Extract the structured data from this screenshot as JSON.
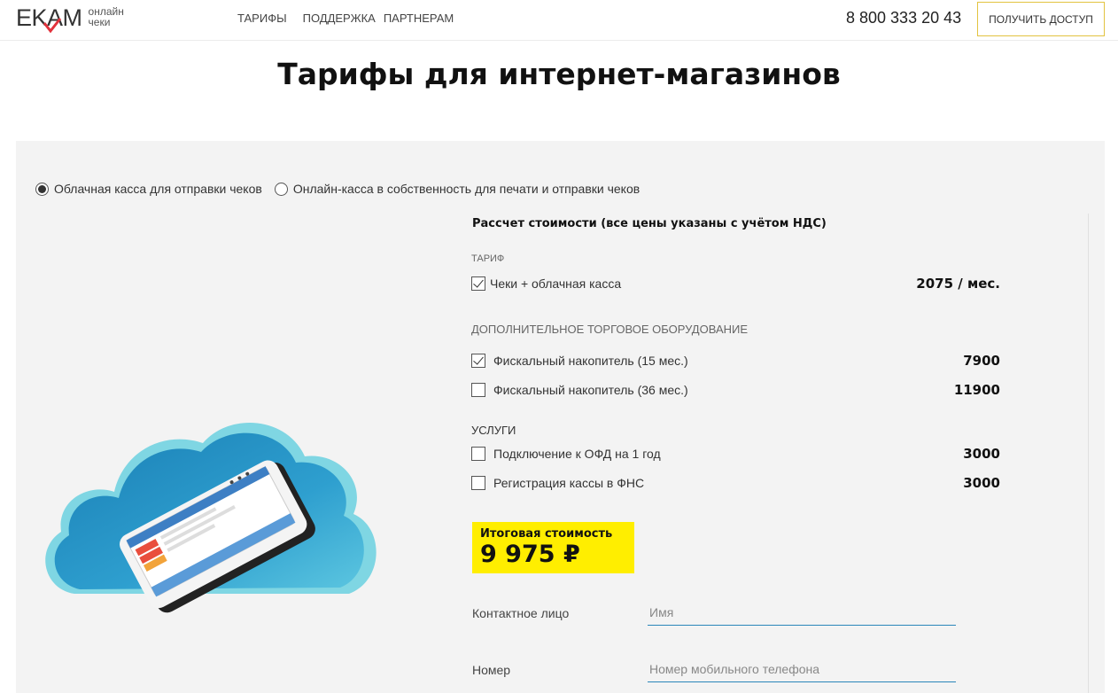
{
  "header": {
    "logo_text": "EKAM",
    "logo_sub_line1": "онлайн",
    "logo_sub_line2": "чеки",
    "nav": [
      "ТАРИФЫ",
      "ПОДДЕРЖКА",
      "ПАРТНЕРАМ"
    ],
    "phone": "8 800 333 20 43",
    "access_button": "ПОЛУЧИТЬ ДОСТУП"
  },
  "page_title": "Тарифы для интернет-магазинов",
  "radio_options": [
    {
      "label": "Облачная касса для отправки чеков",
      "checked": true
    },
    {
      "label": "Онлайн-касса в собственность для печати и отправки чеков",
      "checked": false
    }
  ],
  "calculator": {
    "title": "Рассчет стоимости (все цены указаны с учётом НДС)",
    "tariff_section": "ТАРИФ",
    "tariff_item": {
      "label": "Чеки + облачная касса",
      "price": "2075 / мес.",
      "checked": true
    },
    "equipment_section": "ДОПОЛНИТЕЛЬНОЕ ТОРГОВОЕ ОБОРУДОВАНИЕ",
    "equipment": [
      {
        "label": "Фискальный накопитель (15 мес.)",
        "price": "7900",
        "checked": true
      },
      {
        "label": "Фискальный накопитель (36 мес.)",
        "price": "11900",
        "checked": false
      }
    ],
    "services_section": "УСЛУГИ",
    "services": [
      {
        "label": "Подключение к ОФД на 1 год",
        "price": "3000",
        "checked": false
      },
      {
        "label": "Регистрация кассы в ФНС",
        "price": "3000",
        "checked": false
      }
    ],
    "total_label": "Итоговая стоимость",
    "total_value": "9 975 ₽"
  },
  "form": {
    "contact_label": "Контактное лицо",
    "contact_placeholder": "Имя",
    "phone_label": "Номер",
    "phone_placeholder": "Номер мобильного телефона"
  },
  "colors": {
    "accent_yellow": "#ffee00",
    "button_border": "#e2c340",
    "input_underline": "#2a86b9",
    "logo_check": "#e2323c",
    "panel_bg": "#f3f3f3"
  }
}
